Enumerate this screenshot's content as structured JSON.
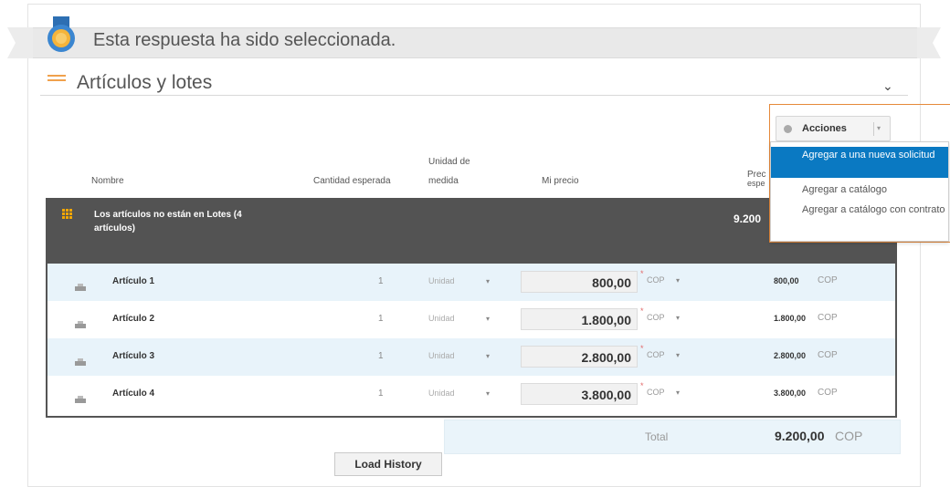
{
  "banner": {
    "title": "Esta respuesta ha sido seleccionada."
  },
  "section": {
    "title": "Artículos y lotes"
  },
  "columns": {
    "name": "Nombre",
    "qty": "Cantidad esperada",
    "unit_line1": "Unidad de",
    "unit_line2": "medida",
    "price": "Mi precio",
    "ext_line1": "Prec",
    "ext_line2": "espe"
  },
  "group": {
    "label": "Los artículos no están en Lotes (4 artículos)",
    "total": "9.200"
  },
  "rows": [
    {
      "name": "Artículo 1",
      "qty": "1",
      "unit": "Unidad",
      "price": "800,00",
      "currency": "COP",
      "ext": "800,00",
      "ext_currency": "COP"
    },
    {
      "name": "Artículo 2",
      "qty": "1",
      "unit": "Unidad",
      "price": "1.800,00",
      "currency": "COP",
      "ext": "1.800,00",
      "ext_currency": "COP"
    },
    {
      "name": "Artículo 3",
      "qty": "1",
      "unit": "Unidad",
      "price": "2.800,00",
      "currency": "COP",
      "ext": "2.800,00",
      "ext_currency": "COP"
    },
    {
      "name": "Artículo 4",
      "qty": "1",
      "unit": "Unidad",
      "price": "3.800,00",
      "currency": "COP",
      "ext": "3.800,00",
      "ext_currency": "COP"
    }
  ],
  "total": {
    "label": "Total",
    "value": "9.200,00",
    "currency": "COP"
  },
  "load_history": "Load History",
  "actions": {
    "label": "Acciones",
    "menu": [
      "Agregar a una nueva solicitud",
      "Agregar a catálogo",
      "Agregar a catálogo con contrato"
    ]
  },
  "colors": {
    "accent": "#0a79c2",
    "group_bar": "#535353",
    "row_alt": "#e8f3fa",
    "highlight": "#e5893a"
  }
}
